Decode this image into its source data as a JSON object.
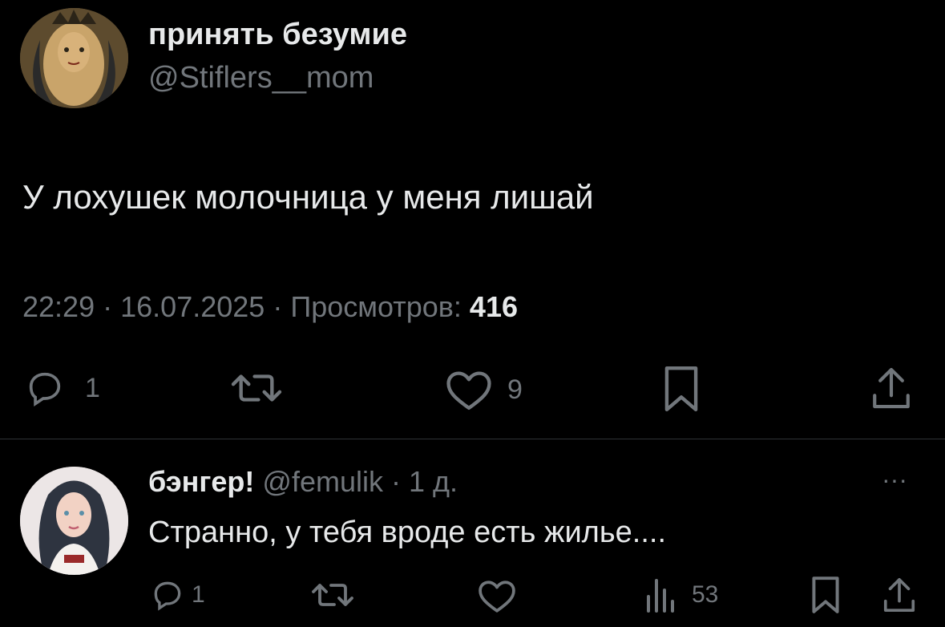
{
  "main_tweet": {
    "display_name": "принять безумие",
    "handle": "@Stiflers__mom",
    "text": "У лохушек молочница у меня лишай",
    "time": "22:29",
    "sep1": "·",
    "date": "16.07.2025",
    "sep2": "·",
    "views_label": "Просмотров:",
    "views_count": "416",
    "actions": {
      "reply_count": "1",
      "like_count": "9"
    }
  },
  "reply": {
    "display_name": "бэнгер!",
    "handle": "@femulik",
    "sep": "·",
    "age": "1 д.",
    "text": "Странно, у тебя вроде есть жилье....",
    "more": "···",
    "actions": {
      "reply_count": "1",
      "views_count": "53"
    }
  },
  "colors": {
    "background": "#000000",
    "text": "#e7e9ea",
    "muted": "#71767b",
    "divider": "#2f3336"
  },
  "icons": [
    "reply-icon",
    "retweet-icon",
    "like-icon",
    "bookmark-icon",
    "share-icon",
    "views-icon",
    "more-icon"
  ]
}
